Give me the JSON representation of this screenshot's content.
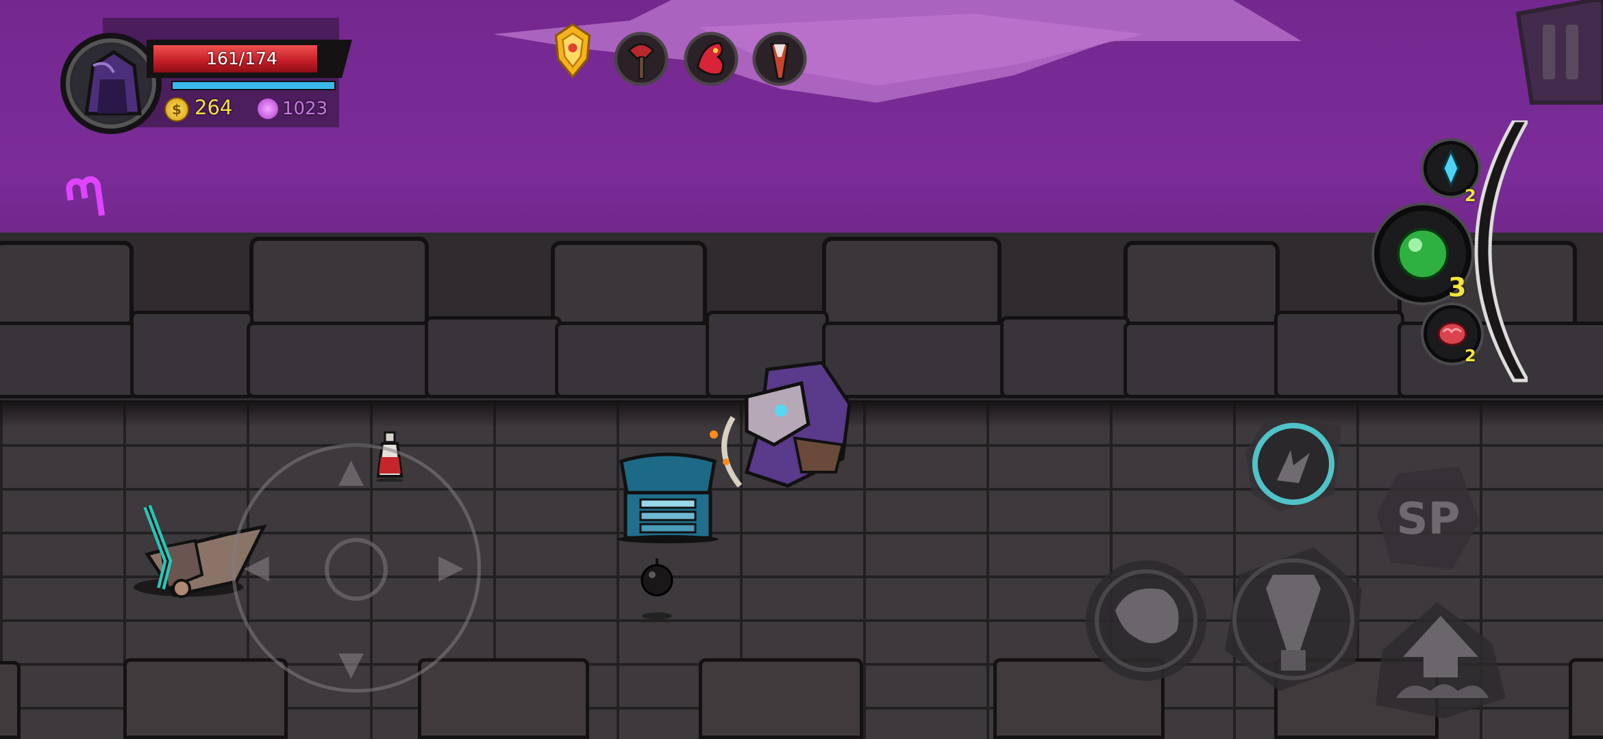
{
  "hud": {
    "hp_text": "161/174",
    "hp_fraction": 0.925,
    "gold": "264",
    "souls": "1023",
    "dash_glyph": "ᘉ"
  },
  "relics": [
    {
      "icon": "golden-shield-relic-icon",
      "color": "#f5b21c"
    },
    {
      "icon": "red-axe-relic-icon",
      "color": "#b8282d"
    },
    {
      "icon": "red-dragon-relic-icon",
      "color": "#d82436"
    },
    {
      "icon": "horn-relic-icon",
      "color": "#c8442f"
    }
  ],
  "quick_items": {
    "crystal_count": "2",
    "green_orb_count": "3",
    "red_brain_count": "2"
  },
  "controls": {
    "sp_label": "SP",
    "skill_ring_color": "#4fc3c7"
  },
  "colors": {
    "sky": "#7b2c98",
    "hp_red": "#c21d26",
    "mp_blue": "#39b9ea",
    "gold_text": "#f5e04a",
    "soul_text": "#c97ae0"
  }
}
